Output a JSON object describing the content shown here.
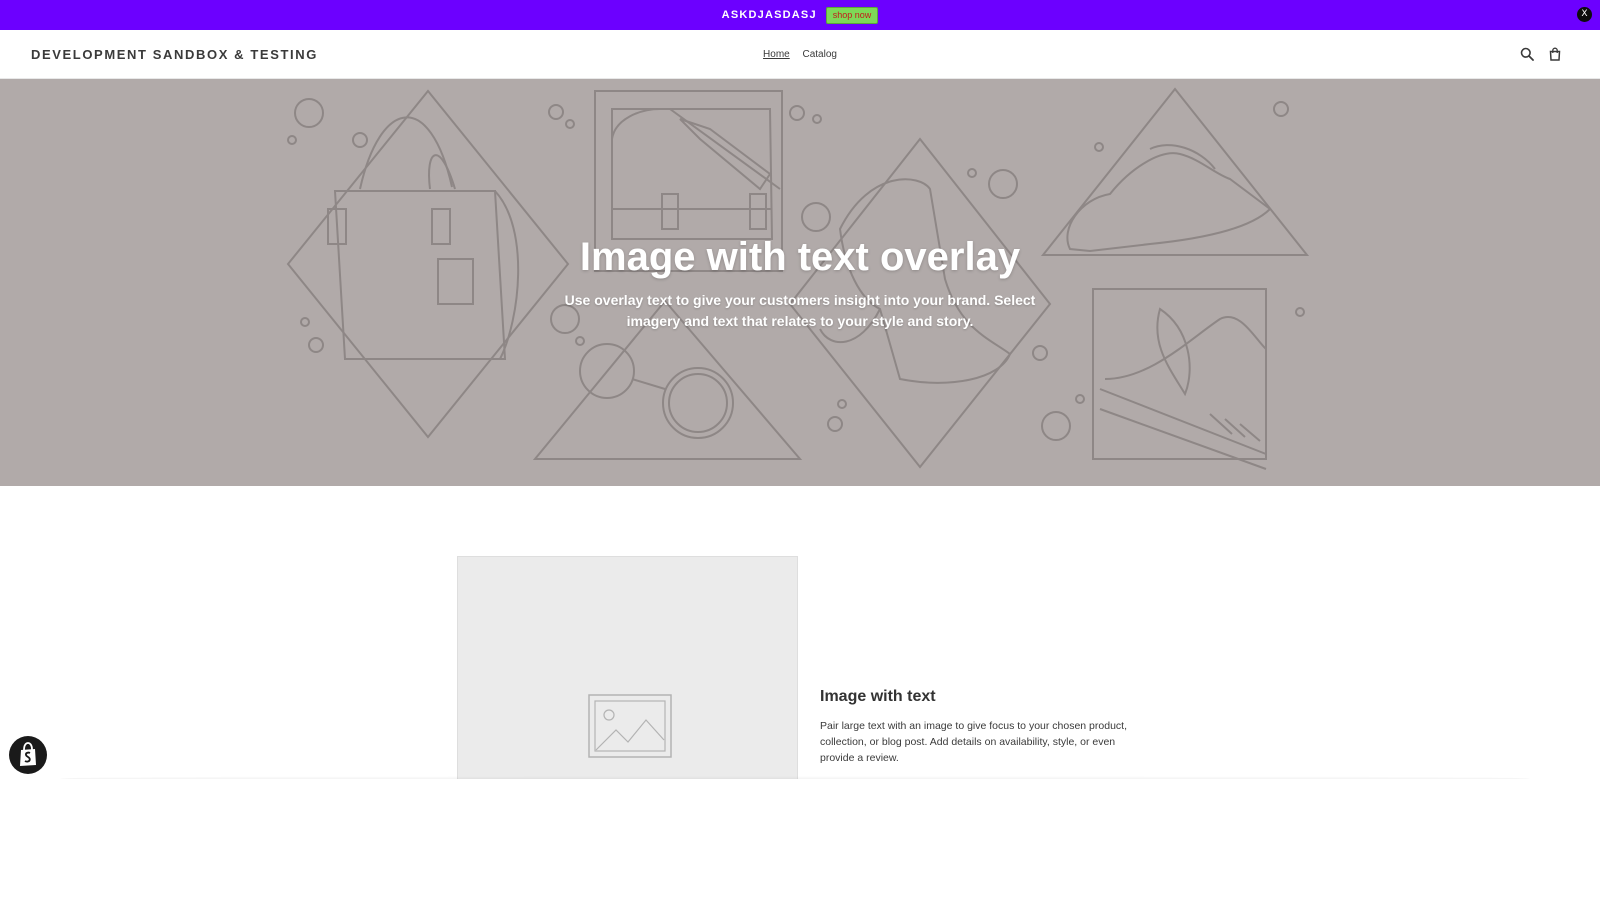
{
  "announcement": {
    "text": "ASKDJASDASJ",
    "button_label": "shop now",
    "close_label": "X",
    "bar_color": "#6c00ff",
    "button_color": "#7ed957"
  },
  "header": {
    "logo": "DEVELOPMENT SANDBOX & TESTING",
    "nav": [
      {
        "label": "Home",
        "active": true
      },
      {
        "label": "Catalog",
        "active": false
      }
    ],
    "icons": [
      "search-icon",
      "cart-icon"
    ]
  },
  "hero": {
    "title": "Image with text overlay",
    "subtitle": "Use overlay text to give your customers insight into your brand. Select imagery and text that relates to your style and story.",
    "background": "#b1aaa9"
  },
  "image_with_text": {
    "title": "Image with text",
    "body": "Pair large text with an image to give focus to your chosen product, collection, or blog post. Add details on availability, style, or even provide a review.",
    "image_icon": "image-placeholder-icon"
  },
  "badge": {
    "icon": "shopify-bag-icon"
  }
}
